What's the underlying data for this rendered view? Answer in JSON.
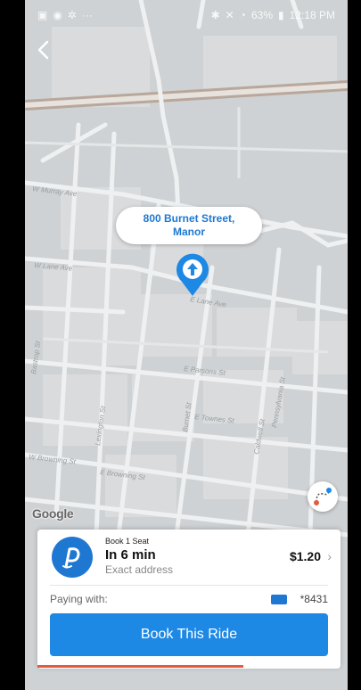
{
  "status_bar": {
    "battery": "63%",
    "time": "12:18 PM"
  },
  "map": {
    "address_bubble": {
      "line1": "800 Burnet Street,",
      "line2": "Manor"
    },
    "street_labels": [
      "W Murray Ave",
      "W Lane Ave",
      "E Lane Ave",
      "E Parsons St",
      "E Townes St",
      "Lexington St",
      "Burnet St",
      "W Browning St",
      "E Browning St",
      "Bastrop St",
      "Pennsylvania St",
      "Caldwell St"
    ],
    "attribution": "Google"
  },
  "ride_card": {
    "seat_label": "Book 1 Seat",
    "eta": "In 6 min",
    "address_type": "Exact address",
    "price": "$1.20",
    "chevron": "›",
    "paying_with_label": "Paying with:",
    "card_number": "*8431",
    "book_button_label": "Book This Ride",
    "progress_fraction": 0.68
  },
  "colors": {
    "brand_blue": "#1e78d2",
    "button_blue": "#1e88e5",
    "progress_red": "#e35b40"
  },
  "icons": {
    "back": "chevron-left-icon",
    "pin": "pickup-pin-icon",
    "route": "route-icon",
    "brand": "via-logo-icon",
    "payment": "credit-card-icon"
  }
}
